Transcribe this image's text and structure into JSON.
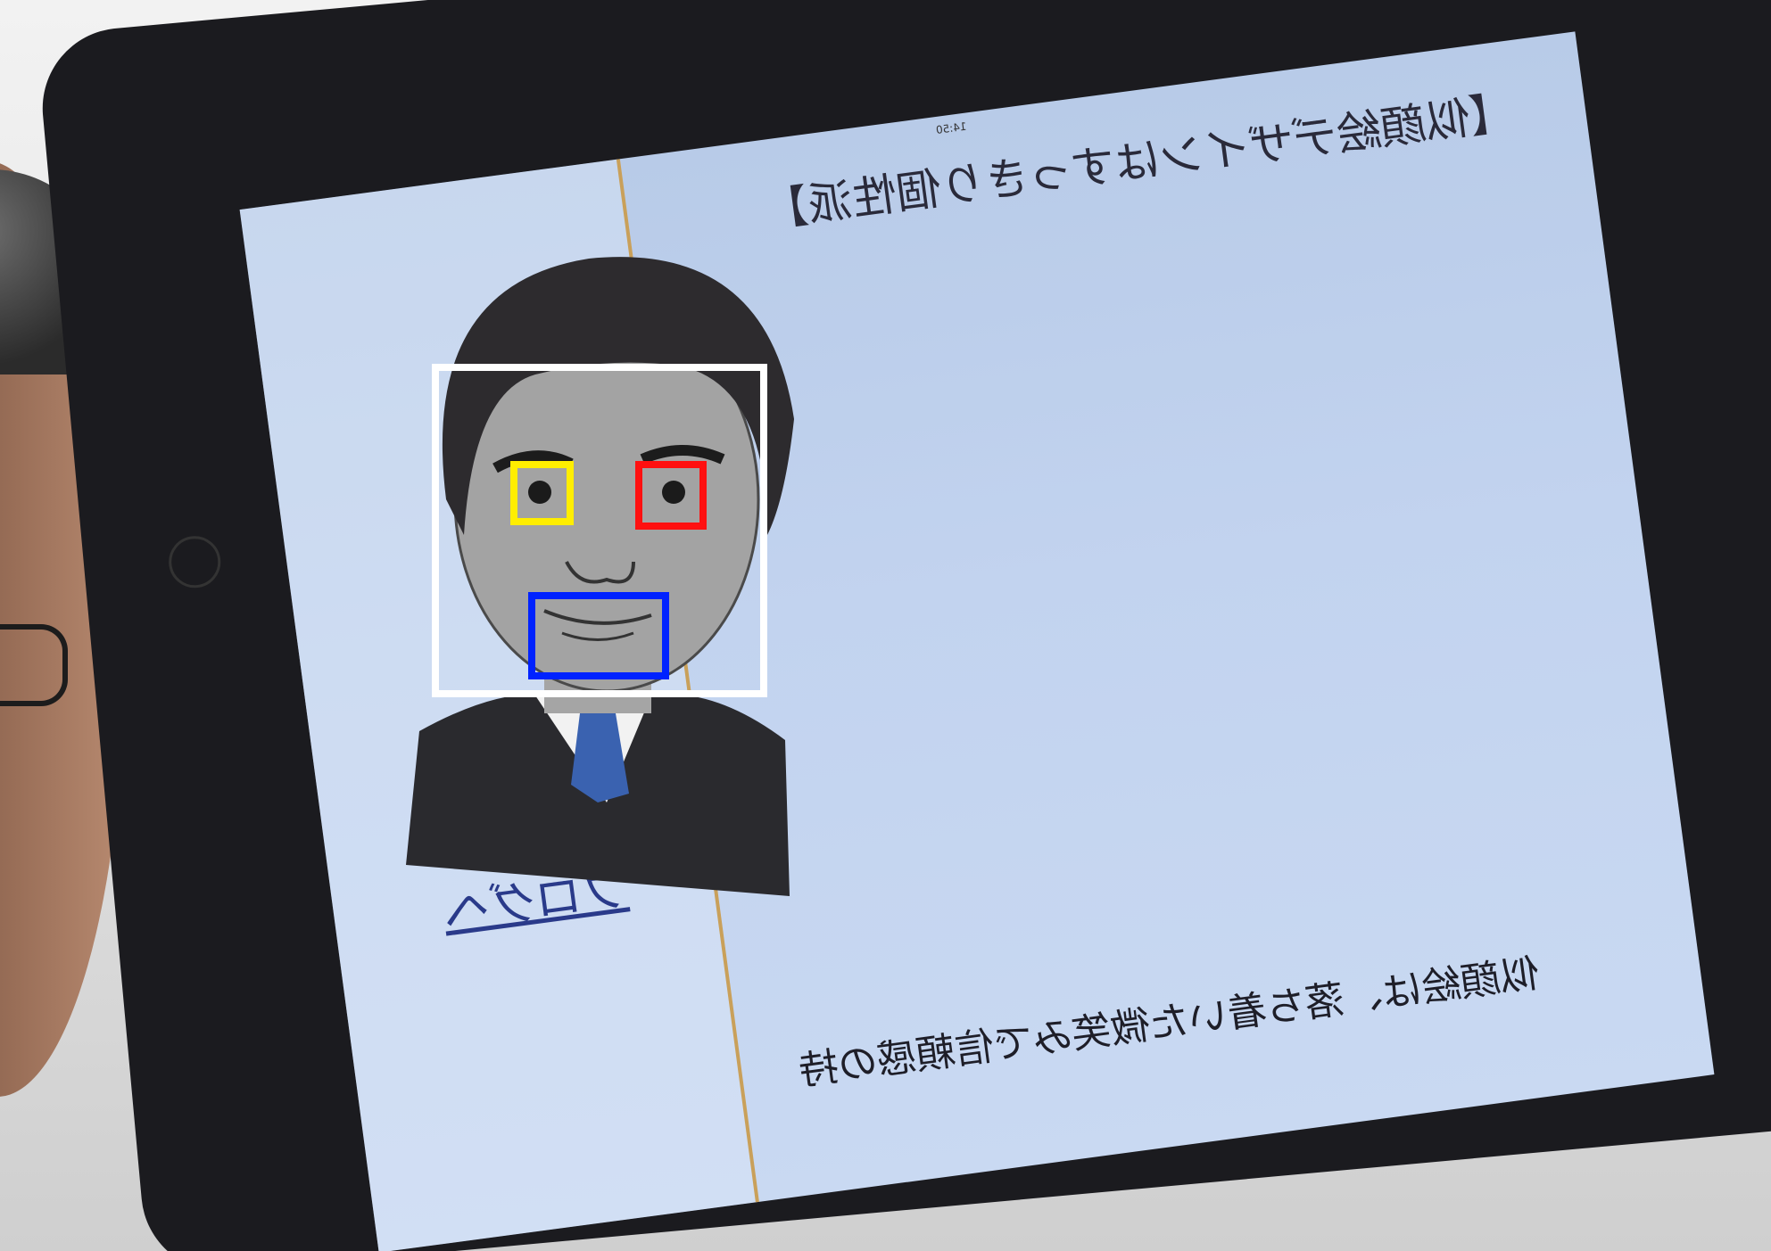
{
  "photo": {
    "screen": {
      "heading": "【似顔絵デザインはすっきり個性派】",
      "caption": "似顔絵は、落ち着いた微笑みで信頼感の持",
      "side_link": "ブログヘ",
      "clock": "14:50"
    },
    "detections": [
      {
        "label": "face",
        "color": "#ffffff"
      },
      {
        "label": "left-eye",
        "color": "#ffee00"
      },
      {
        "label": "right-eye",
        "color": "#ff1010"
      },
      {
        "label": "mouth",
        "color": "#0022ff"
      }
    ]
  }
}
